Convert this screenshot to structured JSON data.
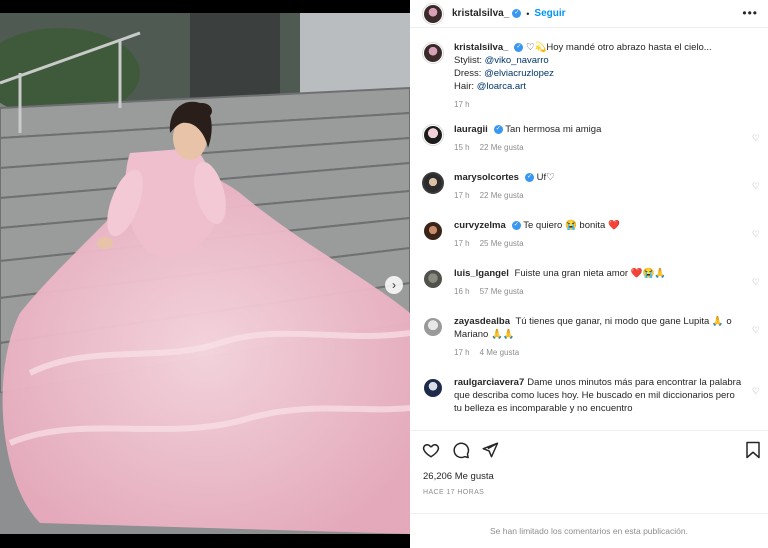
{
  "post": {
    "author": "kristalsilva_",
    "follow_label": "Seguir",
    "more_label": "•••",
    "dot": "•",
    "caption": {
      "line1": "♡💫Hoy mandé otro abrazo hasta el cielo...",
      "stylist_label": "Stylist:",
      "stylist": "@viko_navarro",
      "dress_label": "Dress:",
      "dress": "@elviacruzlopez",
      "hair_label": "Hair:",
      "hair": "@loarca.art",
      "time": "17 h"
    },
    "likes": "26,206 Me gusta",
    "posted_ago": "HACE 17 HORAS",
    "comments_limited": "Se han limitado los comentarios en esta publicación."
  },
  "comments": [
    {
      "user": "lauragii",
      "text": "Tan hermosa mi amiga",
      "time": "15 h",
      "likes": "22 Me gusta",
      "verified": true
    },
    {
      "user": "marysolcortes",
      "text": "Uf♡",
      "time": "17 h",
      "likes": "22 Me gusta",
      "verified": true
    },
    {
      "user": "curvyzelma",
      "text": "Te quiero 😭 bonita ❤️",
      "time": "17 h",
      "likes": "25 Me gusta",
      "verified": true
    },
    {
      "user": "luis_lgangel",
      "text": "Fuiste una gran nieta amor ❤️😭🙏",
      "time": "16 h",
      "likes": "57 Me gusta",
      "verified": false
    },
    {
      "user": "zayasdealba",
      "text": "Tú tienes que ganar, ni modo que gane Lupita 🙏 o Mariano 🙏🙏",
      "time": "17 h",
      "likes": "4 Me gusta",
      "verified": false
    },
    {
      "user": "raulgarciavera7",
      "text": "Dame unos minutos más para encontrar la palabra que describa como luces hoy. He buscado en mil diccionarios pero tu belleza es incomparable y no encuentro",
      "time": "",
      "likes": "",
      "verified": false
    }
  ],
  "icons": {
    "verified": "✓",
    "heart_small": "♡",
    "carousel_next": "›"
  },
  "colors": {
    "accent": "#0095f6",
    "verified": "#3897f0",
    "muted": "#8e8e8e",
    "dress": "#f2c6d3"
  }
}
